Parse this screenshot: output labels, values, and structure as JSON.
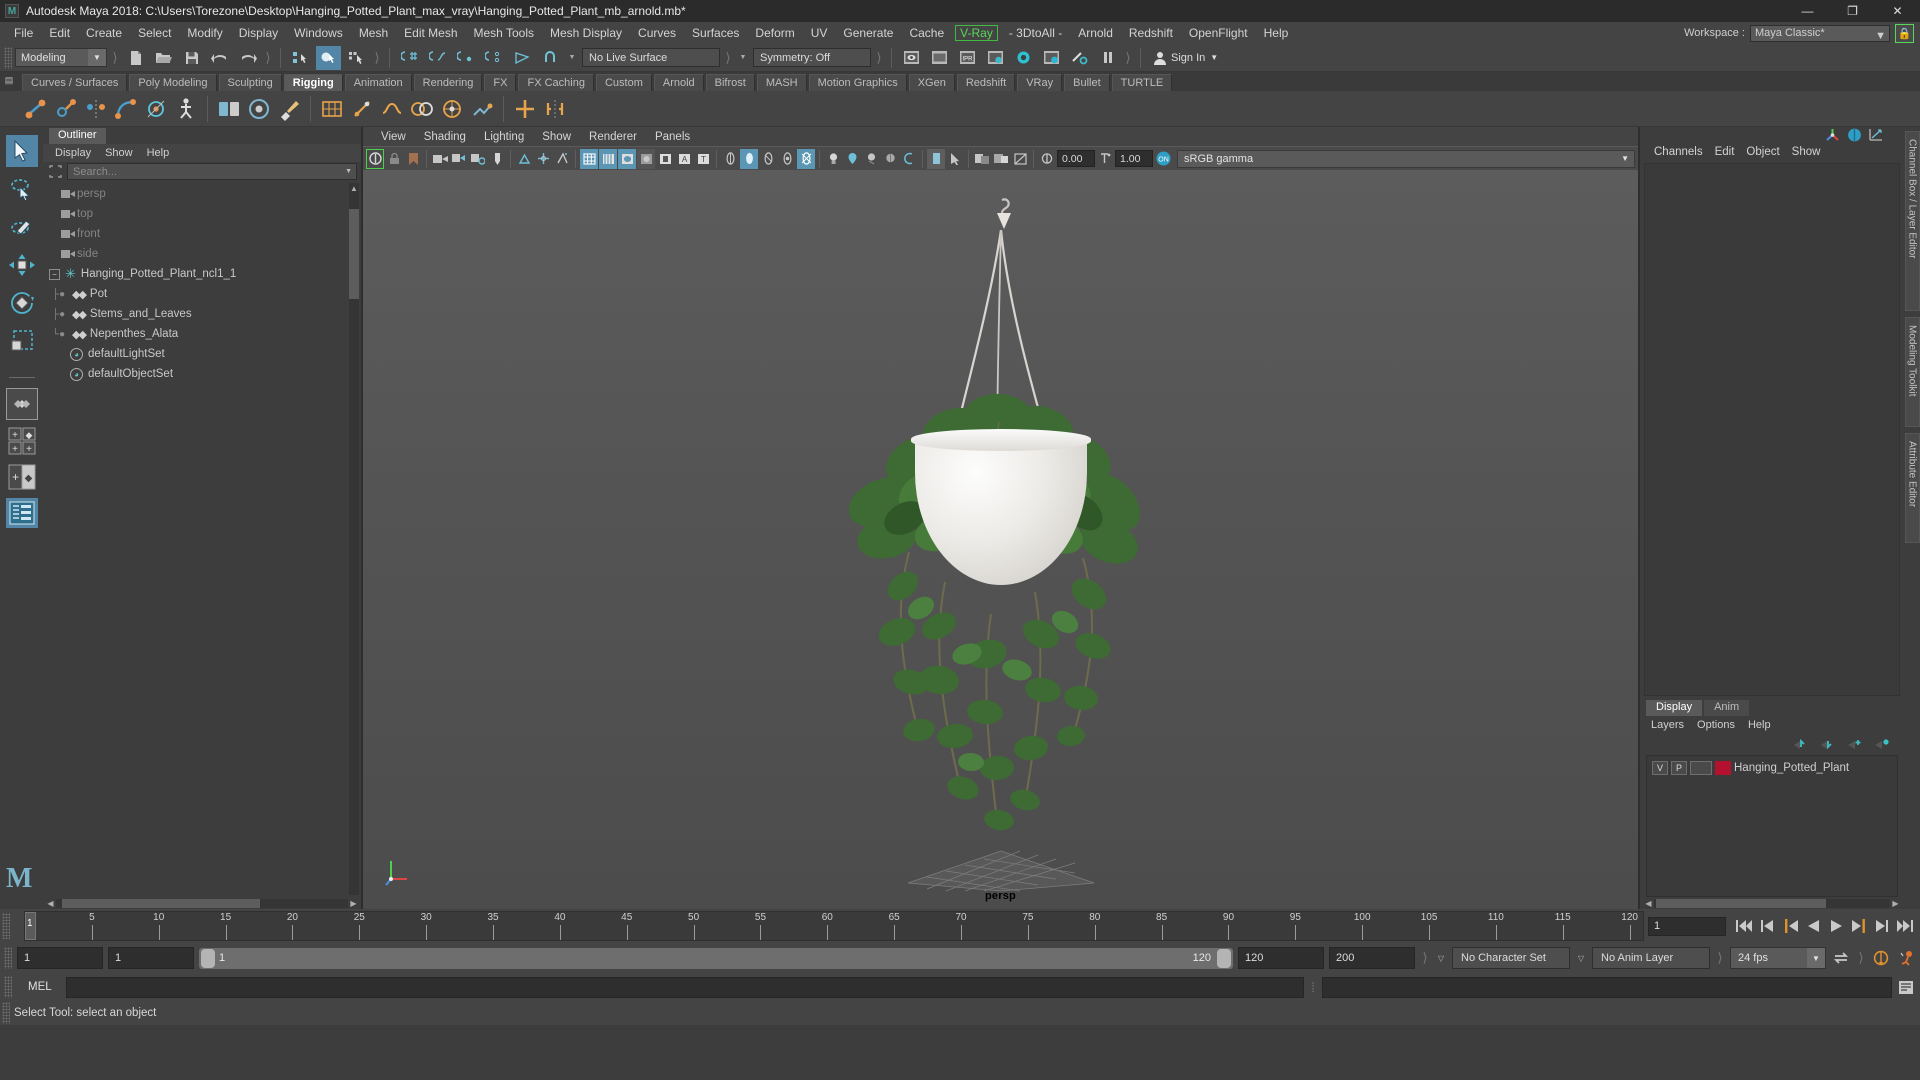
{
  "titlebar": {
    "app_icon": "maya-logo-icon",
    "title": "Autodesk Maya 2018: C:\\Users\\Torezone\\Desktop\\Hanging_Potted_Plant_max_vray\\Hanging_Potted_Plant_mb_arnold.mb*",
    "minimize": "—",
    "maximize": "❐",
    "close": "✕"
  },
  "menubar": {
    "items": [
      "File",
      "Edit",
      "Create",
      "Select",
      "Modify",
      "Display",
      "Windows",
      "Mesh",
      "Edit Mesh",
      "Mesh Tools",
      "Mesh Display",
      "Curves",
      "Surfaces",
      "Deform",
      "UV",
      "Generate",
      "Cache"
    ],
    "vray": "V-Ray",
    "items_after": [
      "- 3DtoAll -",
      "Arnold",
      "Redshift",
      "OpenFlight",
      "Help"
    ],
    "workspace_label": "Workspace :",
    "workspace_value": "Maya Classic*",
    "lock_icon": "lock-icon"
  },
  "statusline": {
    "menuset_value": "Modeling",
    "live_surface": "No Live Surface",
    "symmetry": "Symmetry: Off",
    "signin": "Sign In",
    "icons": [
      "new-scene-icon",
      "open-scene-icon",
      "save-scene-icon",
      "undo-icon",
      "redo-icon",
      "select-hierarchy-icon",
      "select-object-icon",
      "select-component-icon",
      "snap-grid-icon",
      "snap-curve-icon",
      "snap-point-icon",
      "snap-projected-center-icon",
      "snap-view-plane-icon",
      "magnet-icon",
      "render-current-frame-icon",
      "render-sequence-icon",
      "ipr-render-icon",
      "render-settings-icon",
      "hypershade-icon",
      "render-view-icon",
      "render-setup-icon",
      "pause-icon"
    ]
  },
  "shelf": {
    "tabs": [
      "Curves / Surfaces",
      "Poly Modeling",
      "Sculpting",
      "Rigging",
      "Animation",
      "Rendering",
      "FX",
      "FX Caching",
      "Custom",
      "Arnold",
      "Bifrost",
      "MASH",
      "Motion Graphics",
      "XGen",
      "Redshift",
      "VRay",
      "Bullet",
      "TURTLE"
    ],
    "active_tab": "Rigging",
    "icons": [
      "create-joint-icon",
      "insert-joint-icon",
      "mirror-joint-icon",
      "ik-handle-icon",
      "ik-spline-handle-icon",
      "skeleton-icon",
      "bind-skin-icon",
      "interactive-bind-icon",
      "paint-skin-weights-icon",
      "lattice-deformer-icon",
      "cluster-deformer-icon",
      "wire-deformer-icon",
      "blend-shape-icon",
      "wrap-deformer-icon",
      "sculpt-deformer-icon",
      "create-control-icon",
      "mirror-control-icon"
    ]
  },
  "toolbox": {
    "tools": [
      "select-tool",
      "lasso-select-tool",
      "paint-select-tool",
      "move-tool",
      "rotate-tool",
      "scale-tool",
      "last-tool",
      "object-mode-layout",
      "four-view-layout",
      "two-pane-layout",
      "outliner-persp-layout"
    ],
    "selected": "select-tool",
    "logo": "maya-m-logo"
  },
  "outliner": {
    "tab": "Outliner",
    "menu": [
      "Display",
      "Show",
      "Help"
    ],
    "search_placeholder": "Search...",
    "search_value": "",
    "items": [
      {
        "label": "persp",
        "icon": "camera-icon",
        "type": "camera",
        "dim": true,
        "indent": 1
      },
      {
        "label": "top",
        "icon": "camera-icon",
        "type": "camera",
        "dim": true,
        "indent": 1
      },
      {
        "label": "front",
        "icon": "camera-icon",
        "type": "camera",
        "dim": true,
        "indent": 1
      },
      {
        "label": "side",
        "icon": "camera-icon",
        "type": "camera",
        "dim": true,
        "indent": 1
      },
      {
        "label": "Hanging_Potted_Plant_ncl1_1",
        "icon": "transform-star-icon",
        "type": "group",
        "dim": false,
        "indent": 0,
        "expanded": true
      },
      {
        "label": "Pot",
        "icon": "mesh-icon",
        "type": "mesh",
        "dim": false,
        "indent": 1
      },
      {
        "label": "Stems_and_Leaves",
        "icon": "mesh-icon",
        "type": "mesh",
        "dim": false,
        "indent": 1
      },
      {
        "label": "Nepenthes_Alata",
        "icon": "mesh-icon",
        "type": "mesh",
        "dim": false,
        "indent": 1
      },
      {
        "label": "defaultLightSet",
        "icon": "set-icon",
        "type": "set",
        "dim": false,
        "indent": 1
      },
      {
        "label": "defaultObjectSet",
        "icon": "set-icon",
        "type": "set",
        "dim": false,
        "indent": 1
      }
    ]
  },
  "viewport": {
    "menu": [
      "View",
      "Shading",
      "Lighting",
      "Show",
      "Renderer",
      "Panels"
    ],
    "camera_label": "persp",
    "exposure_value": "0.00",
    "gamma_value": "1.00",
    "color_management": "sRGB gamma",
    "toolbar_icons": [
      "select-camera-icon",
      "lock-camera-icon",
      "bookmark-icon",
      "camera-attributes-icon",
      "image-plane-icon",
      "2d-pan-zoom-icon",
      "grease-pencil-icon",
      "gate-mask-icon",
      "resolution-gate-icon",
      "film-gate-icon",
      "wireframe-icon",
      "smooth-shade-icon",
      "shaded-textured-icon",
      "use-all-lights-icon",
      "shadows-icon",
      "screen-space-ao-icon",
      "motion-blur-icon",
      "multisample-icon",
      "depth-of-field-icon",
      "isolate-select-icon",
      "xray-icon",
      "xray-joints-icon",
      "xray-active-components-icon",
      "exposure-icon",
      "gamma-icon",
      "color-management-icon"
    ],
    "on_icon": "color-management-on"
  },
  "channelbox": {
    "icons": [
      "show-manipulator-icon",
      "channel-box-icon",
      "attribute-editor-icon"
    ],
    "menu": [
      "Channels",
      "Edit",
      "Object",
      "Show"
    ]
  },
  "layers": {
    "tabs": [
      "Display",
      "Anim"
    ],
    "active_tab": "Display",
    "menu": [
      "Layers",
      "Options",
      "Help"
    ],
    "buttons": [
      "move-layer-up-icon",
      "move-layer-down-icon",
      "create-new-layer-icon",
      "create-layer-from-selected-icon"
    ],
    "rows": [
      {
        "visibility": "V",
        "playback": "P",
        "reference": "",
        "color": "#b3112f",
        "name": "Hanging_Potted_Plant"
      }
    ]
  },
  "vertical_tabs": [
    "Channel Box / Layer Editor",
    "Modeling Toolkit",
    "Attribute Editor"
  ],
  "timeslider": {
    "current_frame": "1",
    "start_tick": "1",
    "ticks": [
      5,
      10,
      15,
      20,
      25,
      30,
      35,
      40,
      45,
      50,
      55,
      60,
      65,
      70,
      75,
      80,
      85,
      90,
      95,
      100,
      105,
      110,
      115,
      120
    ],
    "playback_buttons": [
      "go-to-start-icon",
      "step-back-frame-icon",
      "step-back-key-icon",
      "play-backwards-icon",
      "play-forwards-icon",
      "step-forward-key-icon",
      "step-forward-frame-icon",
      "go-to-end-icon"
    ]
  },
  "rangeslider": {
    "anim_start": "1",
    "range_start": "1",
    "bar_start_label": "1",
    "bar_end_label": "120",
    "range_end": "120",
    "anim_end": "200",
    "character_set": "No Character Set",
    "anim_layer": "No Anim Layer",
    "fps": "24 fps",
    "icons": [
      "auto-key-icon",
      "animation-preferences-icon",
      "cycle-icon"
    ]
  },
  "commandline": {
    "label": "MEL",
    "input_value": "",
    "output_value": "",
    "icons": [
      "script-editor-icon"
    ]
  },
  "helpline": {
    "text": "Select Tool: select an object"
  }
}
